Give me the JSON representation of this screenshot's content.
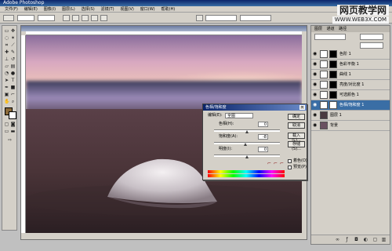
{
  "app": {
    "title": "Adobe Photoshop"
  },
  "menu": [
    "文件(F)",
    "编辑(E)",
    "图像(I)",
    "图层(L)",
    "选择(S)",
    "滤镜(T)",
    "视图(V)",
    "窗口(W)",
    "帮助(H)"
  ],
  "watermark": {
    "line1": "网页教学网",
    "line2": "WWW.WEB3X.COM"
  },
  "layers_panel": {
    "tabs": [
      "图层",
      "通道",
      "路径"
    ],
    "layers": [
      {
        "name": "色阶 1"
      },
      {
        "name": "色彩平衡 1"
      },
      {
        "name": "曲线 1"
      },
      {
        "name": "亮度/对比度 1"
      },
      {
        "name": "可选颜色 1"
      },
      {
        "name": "色相/饱和度 1",
        "selected": true
      },
      {
        "name": "图层 1"
      },
      {
        "name": "背景"
      }
    ]
  },
  "dialog": {
    "title": "色相/饱和度",
    "edit_label": "编辑(E):",
    "edit_value": "全图",
    "hue_label": "色相(H):",
    "hue_value": "0",
    "saturation_label": "饱和度(A):",
    "saturation_value": "-8",
    "lightness_label": "明度(I):",
    "lightness_value": "0",
    "ok_label": "确定",
    "cancel_label": "取消",
    "load_label": "载入(L)...",
    "save_label": "存储(S)...",
    "colorize_label": "着色(O)",
    "preview_label": "预览(P)"
  }
}
